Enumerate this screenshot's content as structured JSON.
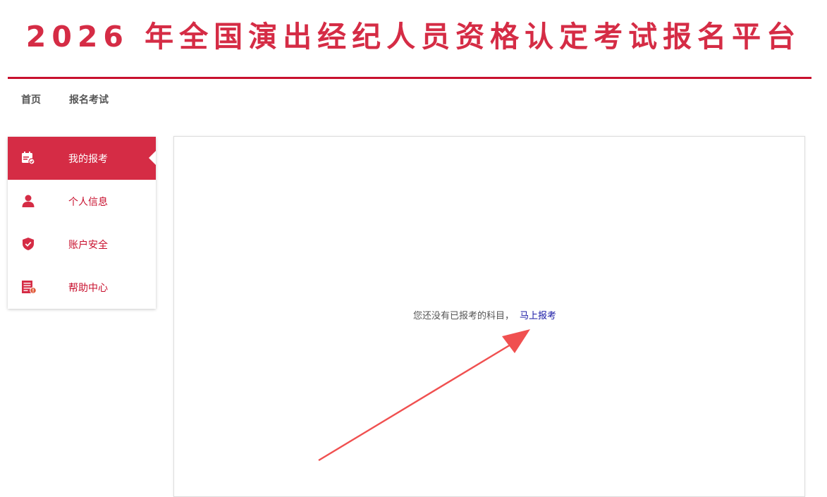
{
  "header": {
    "title": "2026 年全国演出经纪人员资格认定考试报名平台"
  },
  "topnav": {
    "items": [
      {
        "label": "首页"
      },
      {
        "label": "报名考试"
      }
    ]
  },
  "sidebar": {
    "items": [
      {
        "label": "我的报考",
        "icon": "calendar-check-icon",
        "active": true
      },
      {
        "label": "个人信息",
        "icon": "user-icon",
        "active": false
      },
      {
        "label": "账户安全",
        "icon": "shield-check-icon",
        "active": false
      },
      {
        "label": "帮助中心",
        "icon": "document-help-icon",
        "active": false
      }
    ]
  },
  "main": {
    "empty_message": "您还没有已报考的科目，",
    "register_link": "马上报考"
  },
  "colors": {
    "brand": "#d52c45",
    "rule": "#c8102e",
    "link": "#1a1aa6",
    "annotation_arrow": "#f05050"
  }
}
